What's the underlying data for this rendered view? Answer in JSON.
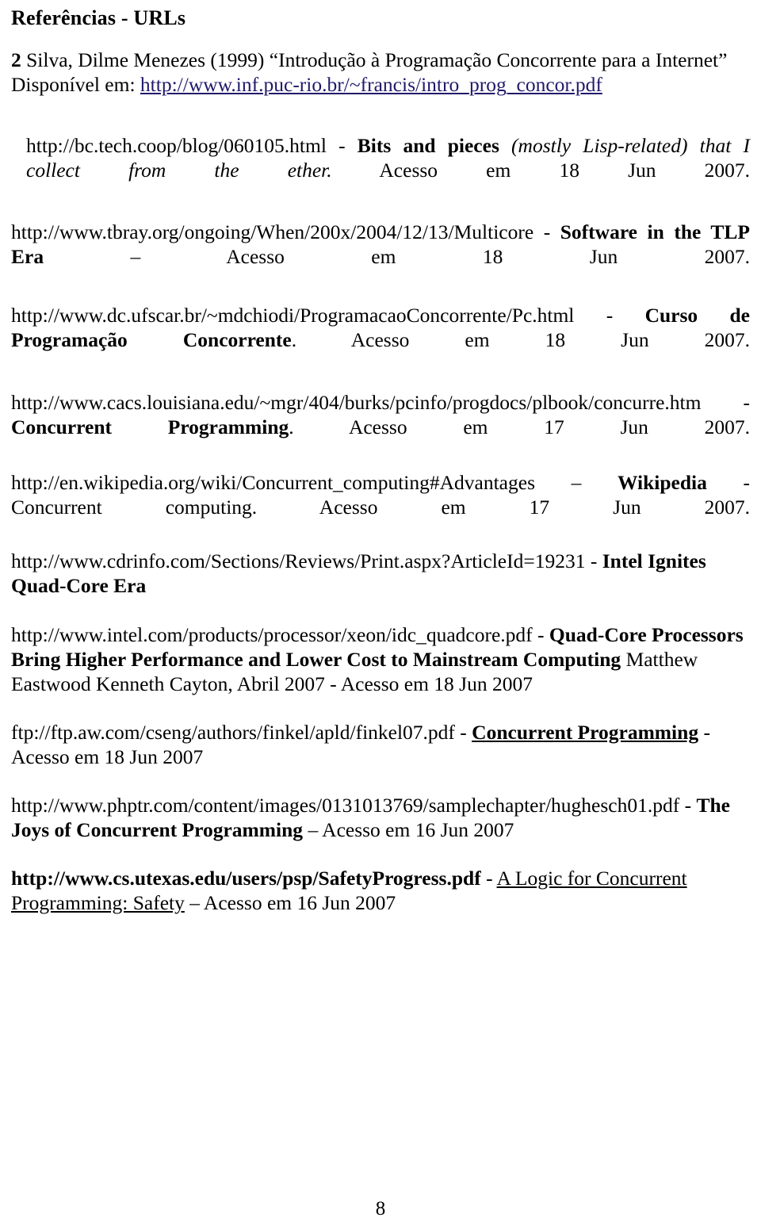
{
  "document": {
    "title": "Referências - URLs",
    "page_number": "8",
    "link_color": "#1f1a6b",
    "text_color": "#000000",
    "background_color": "#ffffff"
  },
  "references": [
    {
      "id": "ref-silva",
      "marker": "2",
      "citation": " Silva, Dilme Menezes (1999) “Introdução à Programação Concorrente para a Internet” Disponível em: ",
      "link_text": "http://www.inf.puc-rio.br/~francis/intro_prog_concor.pdf"
    },
    {
      "id": "ref-bctech",
      "url": "http://bc.tech.coop/blog/060105.html",
      "separator": " - ",
      "title_bold": "Bits and pieces",
      "title_italic": " (mostly Lisp-related) that I collect from the ether.",
      "access": " Acesso em 18 Jun 2007."
    },
    {
      "id": "ref-tbray",
      "url": "http://www.tbray.org/ongoing/When/200x/2004/12/13/Multicore",
      "separator": " - ",
      "title_bold": "Software in the TLP Era",
      "access": " – Acesso em 18 Jun 2007."
    },
    {
      "id": "ref-ufscar",
      "url": "http://www.dc.ufscar.br/~mdchiodi/ProgramacaoConcorrente/Pc.html",
      "separator": " - ",
      "title_bold": "Curso de Programação Concorrente",
      "access": ". Acesso em 18 Jun 2007."
    },
    {
      "id": "ref-louisiana",
      "url": "http://www.cacs.louisiana.edu/~mgr/404/burks/pcinfo/progdocs/plbook/concurre.htm",
      "separator": " - ",
      "title_bold": "Concurrent Programming",
      "access": ". Acesso em 17 Jun 2007."
    },
    {
      "id": "ref-wikipedia",
      "url": "http://en.wikipedia.org/wiki/Concurrent_computing#Advantages",
      "separator": " – ",
      "title_bold": "Wikipedia",
      "title_plain": " - Concurrent computing.",
      "access": " Acesso em 17 Jun 2007."
    },
    {
      "id": "ref-cdrinfo",
      "url": "http://www.cdrinfo.com/Sections/Reviews/Print.aspx?ArticleId=19231",
      "separator": " - ",
      "title_bold": "Intel Ignites Quad-Core Era"
    },
    {
      "id": "ref-intel",
      "url": "http://www.intel.com/products/processor/xeon/idc_quadcore.pdf",
      "separator": " - ",
      "title_bold": "Quad-Core Processors Bring Higher Performance and Lower Cost to Mainstream Computing",
      "authors": " Matthew Eastwood  Kenneth Cayton, Abril 2007 ",
      "access": " - Acesso em 18 Jun 2007"
    },
    {
      "id": "ref-finkel",
      "url": "ftp://ftp.aw.com/cseng/authors/finkel/apld/finkel07.pdf",
      "separator": " - ",
      "title_bold_underline": "Concurrent Programming",
      "access": " - Acesso em 18 Jun 2007"
    },
    {
      "id": "ref-phptr",
      "url": "http://www.phptr.com/content/images/0131013769/samplechapter/hughesch01.pdf",
      "separator": " - ",
      "title_bold": "The Joys of Concurrent Programming",
      "access": " – Acesso em 16 Jun 2007"
    },
    {
      "id": "ref-utexas",
      "url_bold": "http://www.cs.utexas.edu/users/psp/SafetyProgress.pdf",
      "separator": " - ",
      "title_underline": "A Logic for Concurrent Programming: Safety",
      "access": " – Acesso em 16 Jun 2007"
    }
  ]
}
